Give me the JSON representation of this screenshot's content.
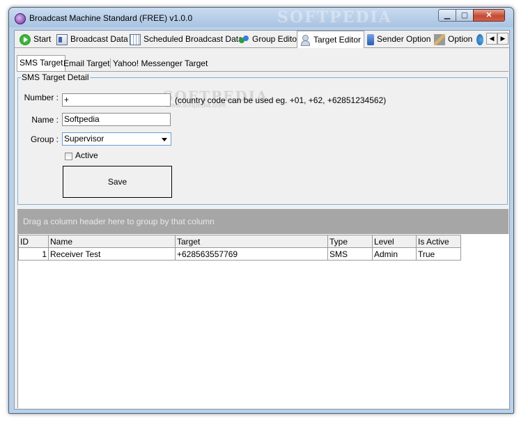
{
  "window": {
    "title": "Broadcast Machine Standard (FREE) v1.0.0",
    "watermark": "SOFTPEDIA",
    "minimize_glyph": "▁",
    "maximize_glyph": "▢",
    "close_glyph": "✕"
  },
  "main_tabs": [
    {
      "label": "Start",
      "icon": "play-icon"
    },
    {
      "label": "Broadcast Data",
      "icon": "broadcast-data-icon"
    },
    {
      "label": "Scheduled Broadcast Data",
      "icon": "calendar-icon"
    },
    {
      "label": "Group Editor",
      "icon": "group-icon"
    },
    {
      "label": "Target Editor",
      "icon": "user-icon",
      "active": true
    },
    {
      "label": "Sender Option",
      "icon": "phone-icon"
    },
    {
      "label": "Option",
      "icon": "tools-icon"
    }
  ],
  "tab_scroll": {
    "left": "◀",
    "right": "▶"
  },
  "sub_tabs": [
    {
      "label": "SMS Target",
      "active": true
    },
    {
      "label": "Email Target"
    },
    {
      "label": "Yahoo! Messenger Target"
    }
  ],
  "detail": {
    "legend": "SMS Target Detail",
    "number_label": "Number :",
    "number_value": "+",
    "number_hint": "(country code can be used eg. +01, +62, +62851234562)",
    "name_label": "Name :",
    "name_value": "Softpedia",
    "group_label": "Group :",
    "group_value": "Supervisor",
    "active_label": "Active",
    "active_checked": false,
    "save_label": "Save",
    "watermark": "SOFTPEDIA",
    "watermark_url": "www.softpedia.com"
  },
  "grid": {
    "group_hint": "Drag a column header here to group by that column",
    "columns": [
      "ID",
      "Name",
      "Target",
      "Type",
      "Level",
      "Is Active"
    ],
    "rows": [
      [
        "1",
        "Receiver Test",
        "+628563557769",
        "SMS",
        "Admin",
        "True"
      ]
    ]
  }
}
